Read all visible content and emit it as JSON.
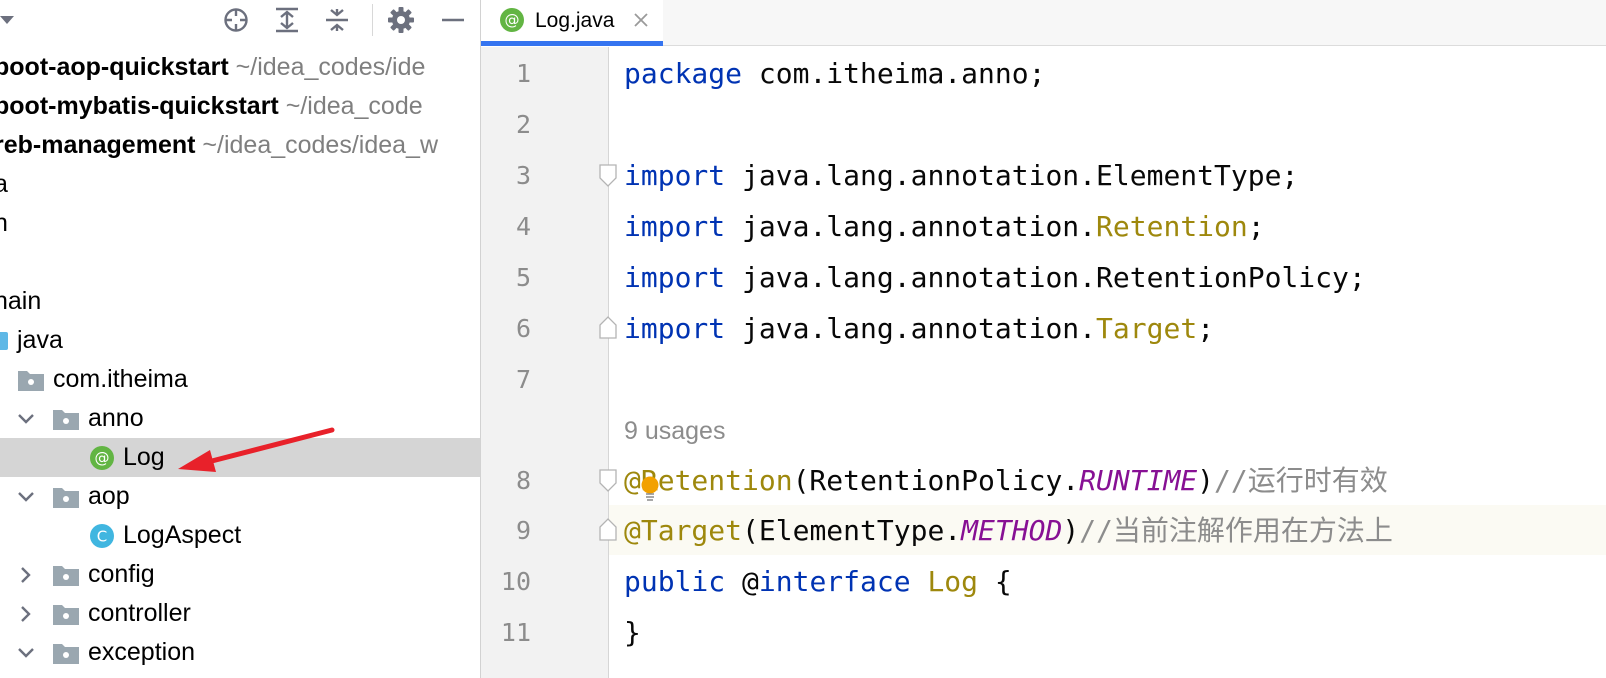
{
  "project_panel": {
    "tree": [
      {
        "bold": "boot-aop-quickstart",
        "path": "~/idea_codes/ide"
      },
      {
        "bold": "boot-mybatis-quickstart",
        "path": "~/idea_code"
      },
      {
        "bold": "reb-management",
        "path": "~/idea_codes/idea_w"
      },
      {
        "label": "a"
      },
      {
        "label": "n"
      },
      {
        "label": ""
      },
      {
        "label": "nain"
      },
      {
        "label": "java"
      },
      {
        "label": "com.itheima"
      },
      {
        "label": "anno"
      },
      {
        "label": "Log"
      },
      {
        "label": "aop"
      },
      {
        "label": "LogAspect"
      },
      {
        "label": "config"
      },
      {
        "label": "controller"
      },
      {
        "label": "exception"
      }
    ]
  },
  "editor": {
    "tab": {
      "label": "Log.java"
    },
    "usages_hint": "9 usages",
    "lines": [
      {
        "num": "1"
      },
      {
        "num": "2"
      },
      {
        "num": "3"
      },
      {
        "num": "4"
      },
      {
        "num": "5"
      },
      {
        "num": "6"
      },
      {
        "num": "7"
      },
      {
        "num": "8"
      },
      {
        "num": "9"
      },
      {
        "num": "10"
      },
      {
        "num": "11"
      }
    ],
    "code": {
      "l1_kw": "package",
      "l1_rest": " com.itheima.anno;",
      "import_kw": "import",
      "l3_rest": " java.lang.annotation.ElementType;",
      "l4_pre": " java.lang.annotation.",
      "l4_ann": "Retention",
      "l4_post": ";",
      "l5_rest": " java.lang.annotation.RetentionPolicy;",
      "l6_pre": " java.lang.annotation.",
      "l6_ann": "Target",
      "l6_post": ";",
      "l8_ann": "@Retention",
      "l8_mid": "(RetentionPolicy.",
      "l8_const": "RUNTIME",
      "l8_close": ")",
      "l8_cmt": "//运行时有效",
      "l9_ann": "@Target",
      "l9_mid": "(ElementType.",
      "l9_const": "METHOD",
      "l9_close": ")",
      "l9_cmt": "//当前注解作用在方法上",
      "l10_kw": "public",
      "l10_at": " @",
      "l10_kw2": "interface",
      "l10_sp": " ",
      "l10_name": "Log",
      "l10_brace": " {",
      "l11": "}"
    }
  },
  "colors": {
    "keyword": "#0033b3",
    "annotation": "#9e880d",
    "constant": "#871094",
    "comment": "#8c8c8c",
    "tab_underline": "#3574f0",
    "selection": "#d5d5d5",
    "arrow": "#e8212a"
  },
  "icons": {
    "toolbar": [
      "locate-icon",
      "expand-all-icon",
      "collapse-all-icon",
      "gear-icon",
      "minimize-icon"
    ],
    "tab": "annotation-file-icon",
    "close": "close-icon"
  }
}
